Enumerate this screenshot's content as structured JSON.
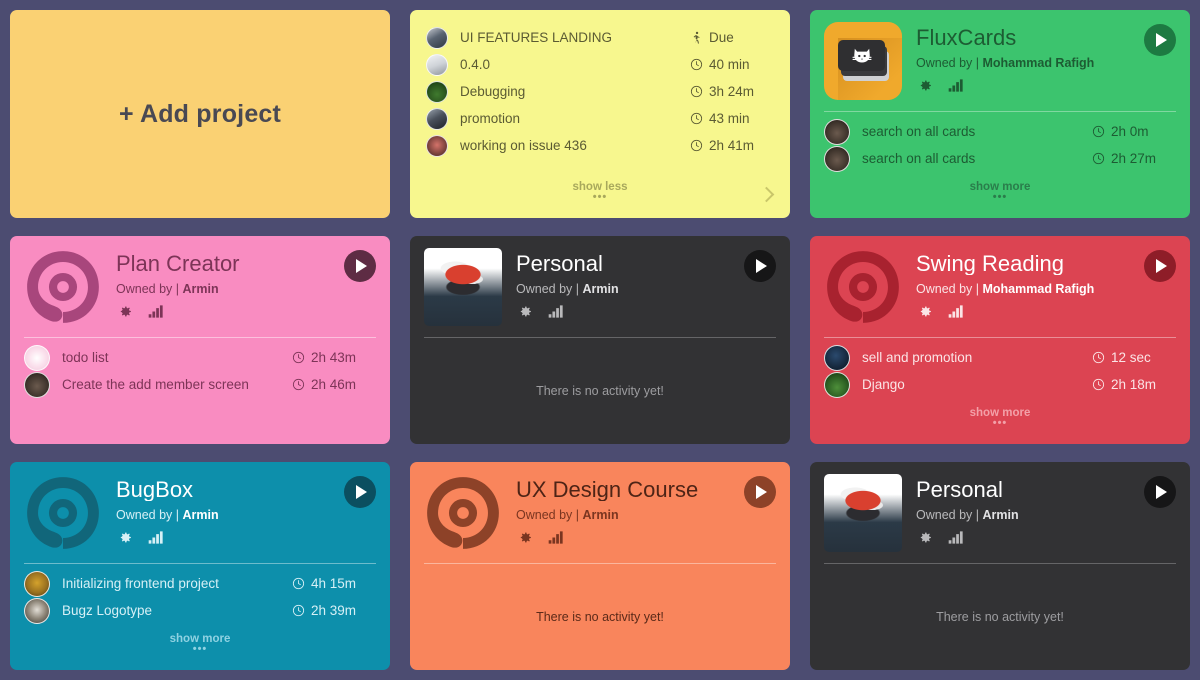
{
  "theme": {
    "page_bg": "#4c4c71",
    "add_card_bg": "#fad173",
    "tasklist_bg": "#f7f78e",
    "flux_bg": "#3cc46e",
    "plan_bg": "#f98cc1",
    "personal_bg": "#323234",
    "swing_bg": "#dc4452",
    "bugbox_bg": "#0d8fab",
    "ux_bg": "#f9855c"
  },
  "add_card": {
    "label": "+ Add project"
  },
  "labels": {
    "owned_by": "Owned by |",
    "show_more": "show more",
    "show_less": "show less",
    "dots": "•••",
    "no_activity": "There is no activity yet!",
    "due": "Due"
  },
  "icons": {
    "gear": "gear-icon",
    "chart": "bar-chart-icon",
    "clock": "clock-icon",
    "walking": "walking-person-icon",
    "play": "play-icon",
    "chevron": "chevron-right-icon"
  },
  "cards": [
    {
      "id": "tasklist",
      "type": "tasklist",
      "footer": "show less",
      "tasks": [
        {
          "name": "UI FEATURES LANDING",
          "time": "Due",
          "icon": "walking-person-icon",
          "avatar": "ph-a"
        },
        {
          "name": "0.4.0",
          "time": "40 min",
          "icon": "clock-icon",
          "avatar": "ph-b"
        },
        {
          "name": "Debugging",
          "time": "3h 24m",
          "icon": "clock-icon",
          "avatar": "ph-c"
        },
        {
          "name": "promotion",
          "time": "43 min",
          "icon": "clock-icon",
          "avatar": "ph-d"
        },
        {
          "name": "working on issue 436",
          "time": "2h 41m",
          "icon": "clock-icon",
          "avatar": "ph-e"
        }
      ]
    },
    {
      "id": "fluxcards",
      "type": "project",
      "title": "FluxCards",
      "owner": "Mohammad Rafigh",
      "logo": "fluxcards-logo",
      "footer": "show more",
      "tasks": [
        {
          "name": "search on all cards",
          "time": "2h 0m",
          "avatar": "ph-f"
        },
        {
          "name": "search on all cards",
          "time": "2h 27m",
          "avatar": "ph-f"
        }
      ]
    },
    {
      "id": "plan-creator",
      "type": "project",
      "title": "Plan Creator",
      "owner": "Armin",
      "logo": "ring-logo",
      "footer": "show more",
      "tasks": [
        {
          "name": "todo list",
          "time": "2h 43m",
          "avatar": "ph-pink"
        },
        {
          "name": "Create the add member screen",
          "time": "2h 46m",
          "avatar": "ph-f"
        }
      ]
    },
    {
      "id": "personal-top",
      "type": "project",
      "title": "Personal",
      "owner": "Armin",
      "logo": "photo-logo",
      "empty_text": "There is no activity yet!",
      "tasks": []
    },
    {
      "id": "swing-reading",
      "type": "project",
      "title": "Swing Reading",
      "owner": "Mohammad Rafigh",
      "logo": "ring-logo",
      "footer": "show more",
      "tasks": [
        {
          "name": "sell and promotion",
          "time": "12 sec",
          "avatar": "ph-h"
        },
        {
          "name": "Django",
          "time": "2h 18m",
          "avatar": "ph-i"
        }
      ]
    },
    {
      "id": "bugbox",
      "type": "project",
      "title": "BugBox",
      "owner": "Armin",
      "logo": "ring-logo",
      "footer": "show more",
      "tasks": [
        {
          "name": "Initializing frontend project",
          "time": "4h 15m",
          "avatar": "ph-j"
        },
        {
          "name": "Bugz Logotype",
          "time": "2h 39m",
          "avatar": "ph-k"
        }
      ]
    },
    {
      "id": "ux-design-course",
      "type": "project",
      "title": "UX Design Course",
      "owner": "Armin",
      "logo": "ring-logo",
      "empty_text": "There is no activity yet!",
      "tasks": []
    },
    {
      "id": "personal-bottom",
      "type": "project",
      "title": "Personal",
      "owner": "Armin",
      "logo": "photo-logo",
      "empty_text": "There is no activity yet!",
      "tasks": []
    }
  ]
}
